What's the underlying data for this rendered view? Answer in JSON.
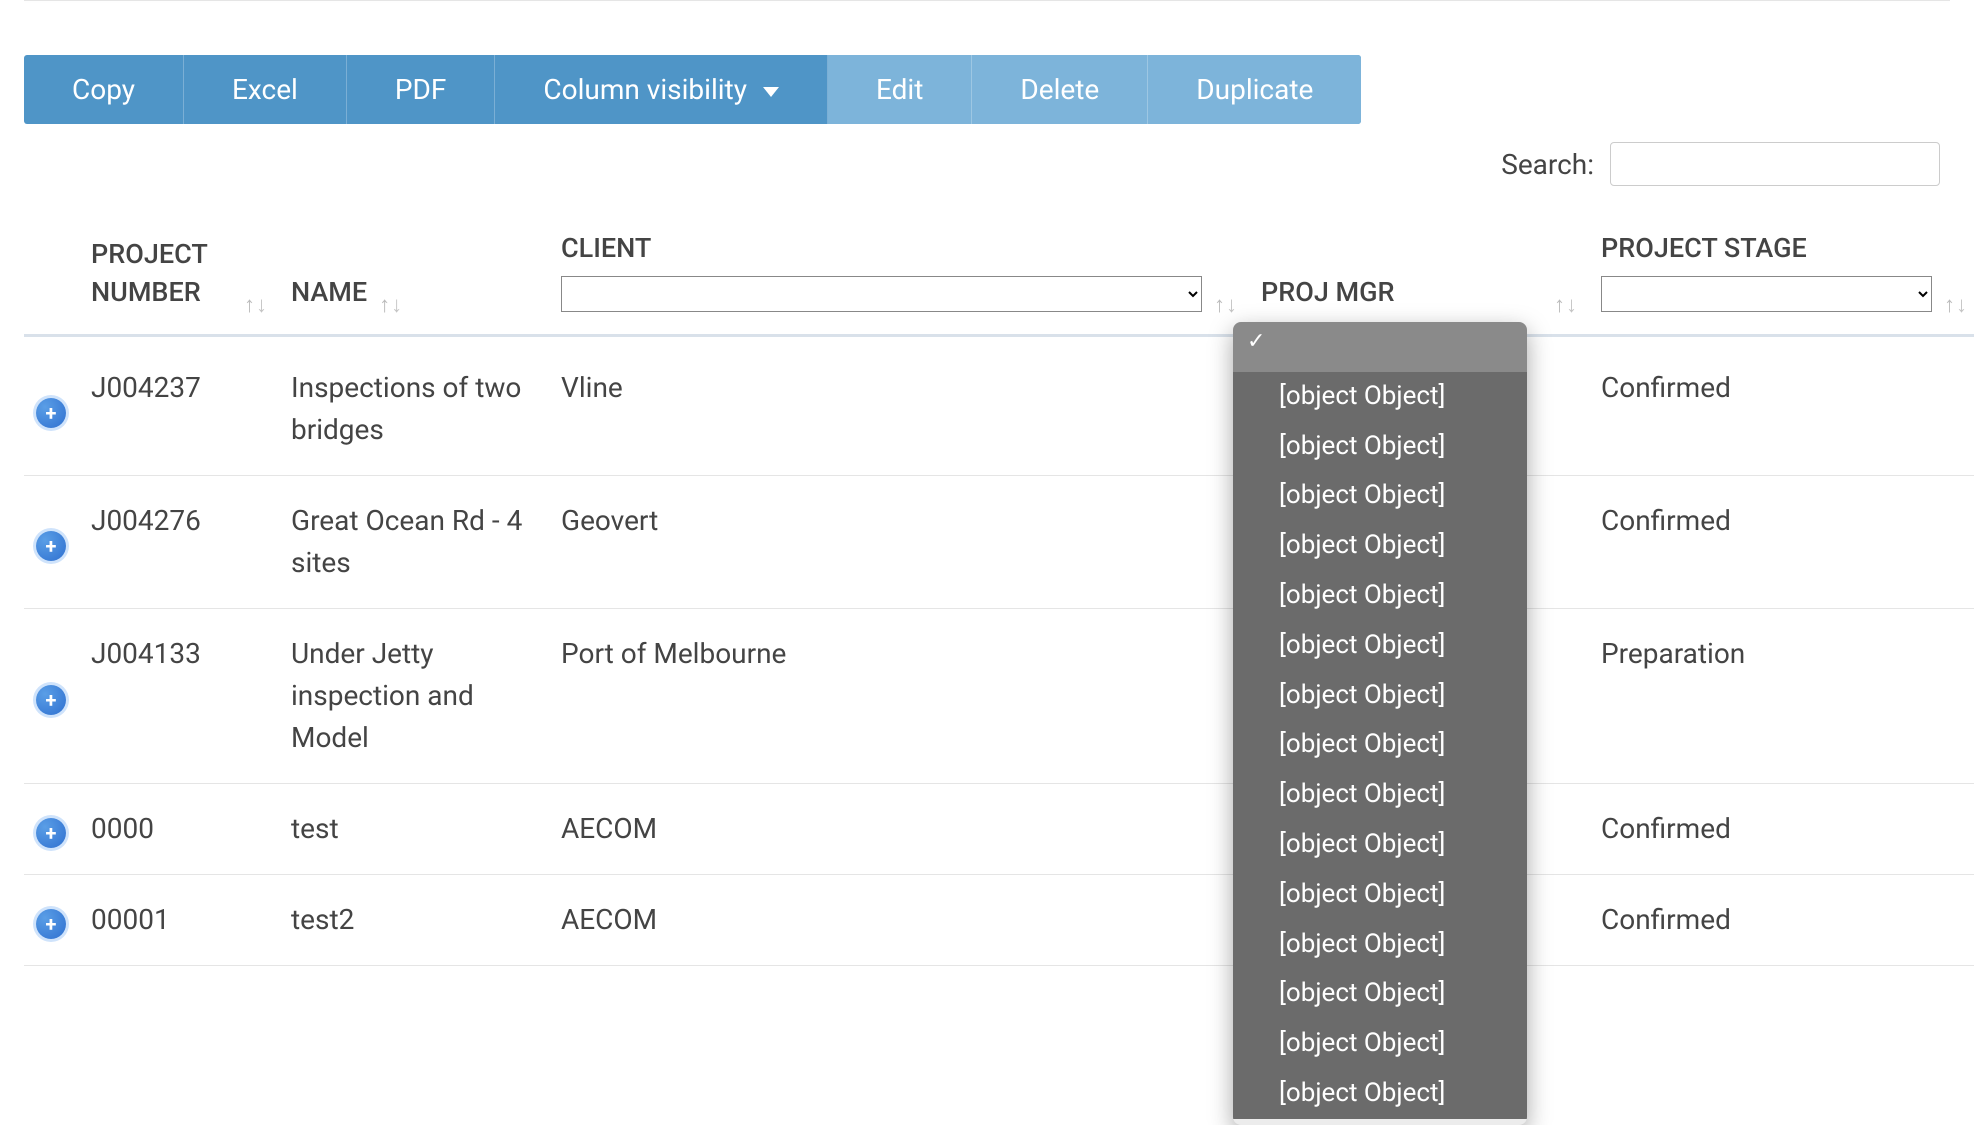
{
  "toolbar": {
    "buttons": [
      {
        "id": "copy",
        "label": "Copy",
        "disabled": false,
        "caret": false
      },
      {
        "id": "excel",
        "label": "Excel",
        "disabled": false,
        "caret": false
      },
      {
        "id": "pdf",
        "label": "PDF",
        "disabled": false,
        "caret": false
      },
      {
        "id": "colvis",
        "label": "Column visibility",
        "disabled": false,
        "caret": true
      },
      {
        "id": "edit",
        "label": "Edit",
        "disabled": true,
        "caret": false
      },
      {
        "id": "delete",
        "label": "Delete",
        "disabled": true,
        "caret": false
      },
      {
        "id": "dup",
        "label": "Duplicate",
        "disabled": true,
        "caret": false
      }
    ]
  },
  "search": {
    "label": "Search:",
    "value": ""
  },
  "columns": {
    "project_number": "PROJECT NUMBER",
    "name": "NAME",
    "client": "CLIENT",
    "proj_mgr": "PROJ MGR",
    "project_stage": "PROJECT STAGE"
  },
  "filters": {
    "client_selected": "",
    "proj_mgr_selected": "",
    "project_stage_selected": "",
    "proj_mgr_open": true,
    "proj_mgr_options": [
      "",
      "[object Object]",
      "[object Object]",
      "[object Object]",
      "[object Object]",
      "[object Object]",
      "[object Object]",
      "[object Object]",
      "[object Object]",
      "[object Object]",
      "[object Object]",
      "[object Object]",
      "[object Object]",
      "[object Object]",
      "[object Object]",
      "[object Object]"
    ]
  },
  "rows": [
    {
      "project_number": "J004237",
      "name": "Inspections of two bridges",
      "client": "Vline",
      "proj_mgr": "",
      "stage": {
        "text": "Confirmed",
        "class": "stage-confirmed"
      }
    },
    {
      "project_number": "J004276",
      "name": "Great Ocean Rd - 4 sites",
      "client": "Geovert",
      "proj_mgr": "",
      "stage": {
        "text": "Confirmed",
        "class": "stage-confirmed"
      }
    },
    {
      "project_number": "J004133",
      "name": "Under Jetty inspection and Model",
      "client": "Port of Melbourne",
      "proj_mgr": "",
      "stage": {
        "text": "Preparation",
        "class": "stage-preparation"
      }
    },
    {
      "project_number": "0000",
      "name": "test",
      "client": "AECOM",
      "proj_mgr": "",
      "stage": {
        "text": "Confirmed",
        "class": "stage-confirmed"
      }
    },
    {
      "project_number": "00001",
      "name": "test2",
      "client": "AECOM",
      "proj_mgr": "",
      "stage": {
        "text": "Confirmed",
        "class": "stage-confirmed"
      }
    }
  ]
}
